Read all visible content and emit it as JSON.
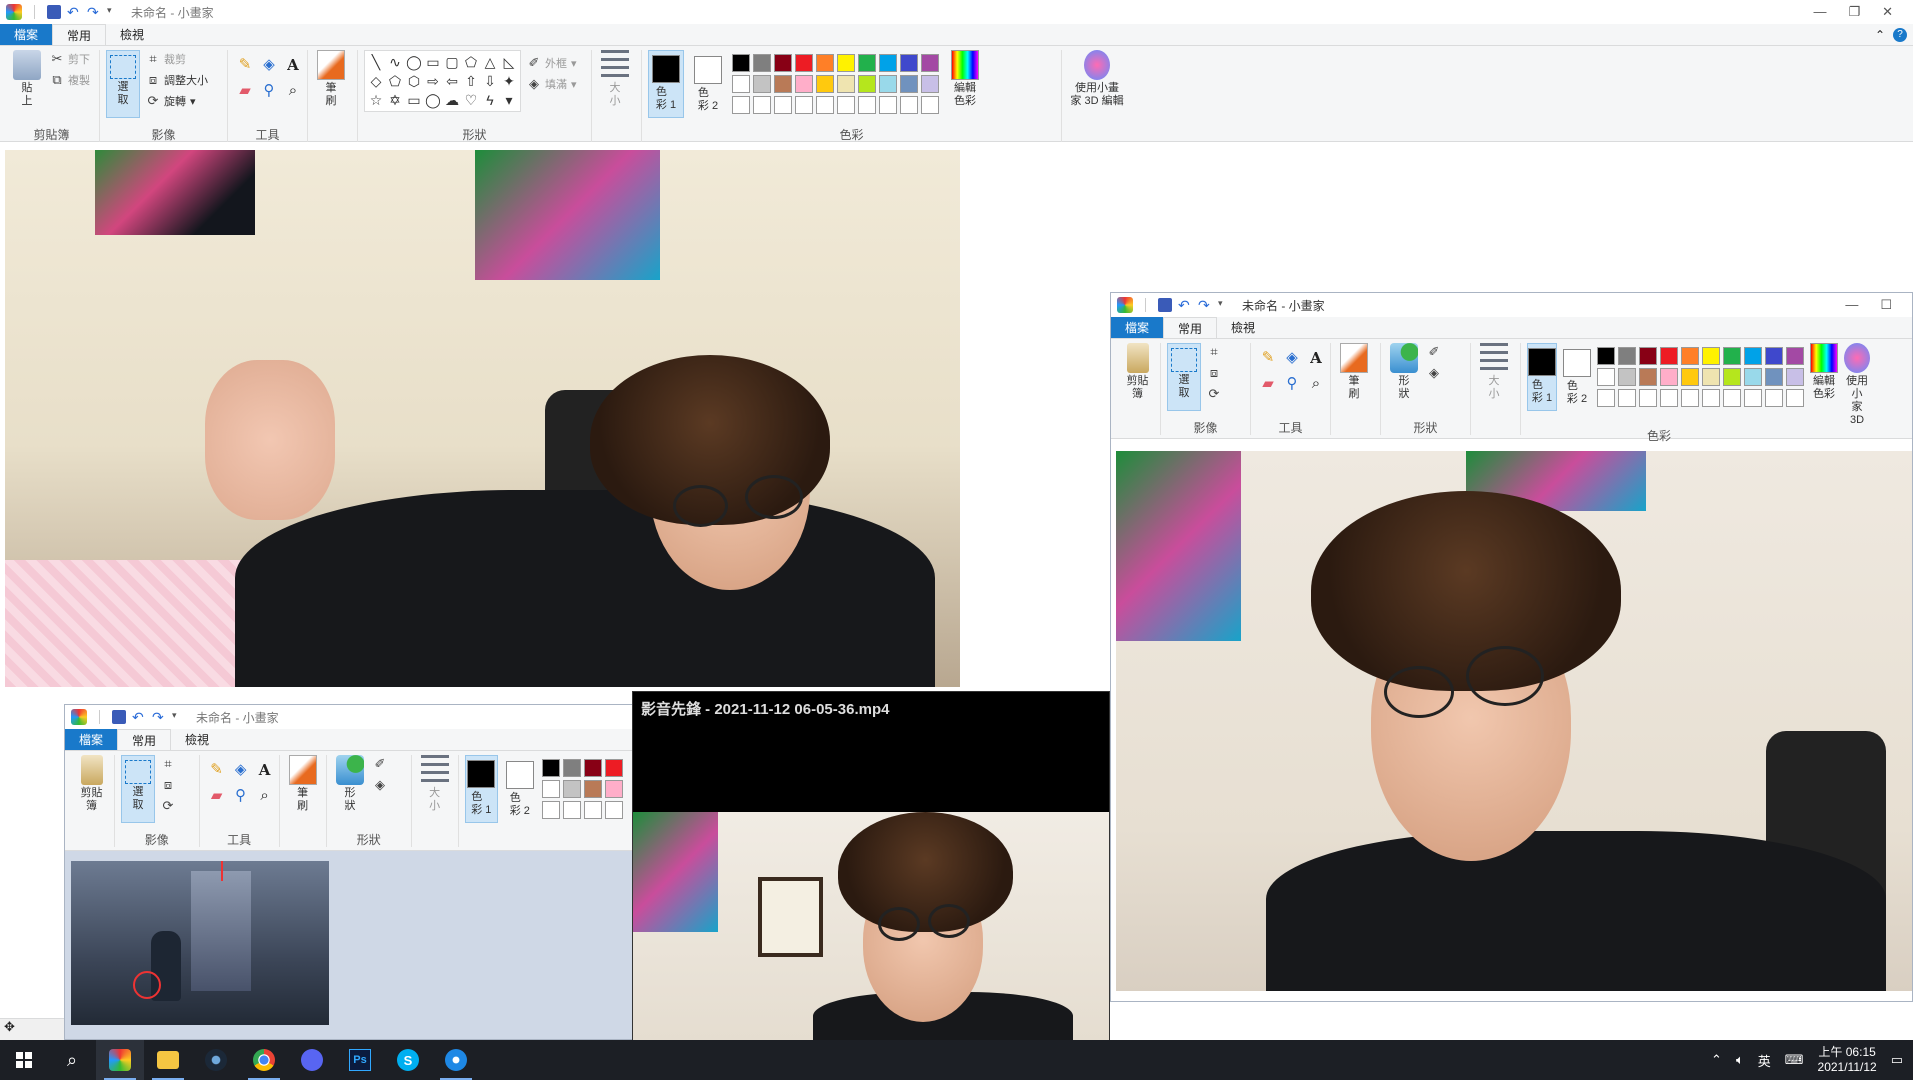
{
  "main_paint": {
    "title": "未命名 - 小畫家",
    "tabs": {
      "file": "檔案",
      "home": "常用",
      "view": "檢視"
    },
    "clipboard": {
      "paste": "貼\n上",
      "cut": "剪下",
      "copy": "複製",
      "label": "剪貼簿"
    },
    "image": {
      "select": "選\n取",
      "crop": "裁剪",
      "resize": "調整大小",
      "rotate": "旋轉",
      "label": "影像"
    },
    "tools": {
      "label": "工具"
    },
    "brushes": {
      "label": "筆\n刷"
    },
    "shapes": {
      "outline": "外框",
      "fill": "填滿",
      "label": "形狀"
    },
    "size": {
      "label": "大\n小"
    },
    "colors": {
      "color1": "色\n彩 1",
      "color2": "色\n彩 2",
      "edit": "編輯\n色彩",
      "paint3d": "使用小畫\n家 3D 編輯",
      "label": "色彩"
    }
  },
  "right_paint": {
    "title": "未命名 - 小畫家",
    "tabs": {
      "file": "檔案",
      "home": "常用",
      "view": "檢視"
    },
    "clipboard_label": "剪貼\n簿",
    "select_label": "選\n取",
    "brushes_label": "筆\n刷",
    "shapes_btn": "形\n狀",
    "size_label": "大\n小",
    "color1": "色\n彩 1",
    "color2": "色\n彩 2",
    "edit_colors": "編輯\n色彩",
    "paint3d": "使用小\n家 3D",
    "groups": {
      "image": "影像",
      "tools": "工具",
      "shapes": "形狀",
      "colors": "色彩"
    }
  },
  "small_paint": {
    "title": "未命名 - 小畫家",
    "tabs": {
      "file": "檔案",
      "home": "常用",
      "view": "檢視"
    },
    "clipboard_label": "剪貼\n簿",
    "select_label": "選\n取",
    "brushes_label": "筆\n刷",
    "shapes_btn": "形\n狀",
    "size_label": "大\n小",
    "color1": "色\n彩 1",
    "color2": "色\n彩 2",
    "groups": {
      "image": "影像",
      "tools": "工具",
      "shapes": "形狀"
    }
  },
  "player": {
    "title": "影音先鋒 - 2021-11-12 06-05-36.mp4"
  },
  "palette": [
    "#000000",
    "#7f7f7f",
    "#880015",
    "#ed1c24",
    "#ff7f27",
    "#fff200",
    "#22b14c",
    "#00a2e8",
    "#3f48cc",
    "#a349a4",
    "#ffffff",
    "#c3c3c3",
    "#b97a57",
    "#ffaec9",
    "#ffc90e",
    "#efe4b0",
    "#b5e61d",
    "#99d9ea",
    "#7092be",
    "#c8bfe7",
    "#ffffff",
    "#ffffff",
    "#ffffff",
    "#ffffff",
    "#ffffff",
    "#ffffff",
    "#ffffff",
    "#ffffff",
    "#ffffff",
    "#ffffff"
  ],
  "taskbar": {
    "clock_time": "上午 06:15",
    "clock_date": "2021/11/12",
    "ime": "英"
  },
  "colors": {
    "accent": "#1979ca",
    "taskbar": "#1c1f25"
  }
}
